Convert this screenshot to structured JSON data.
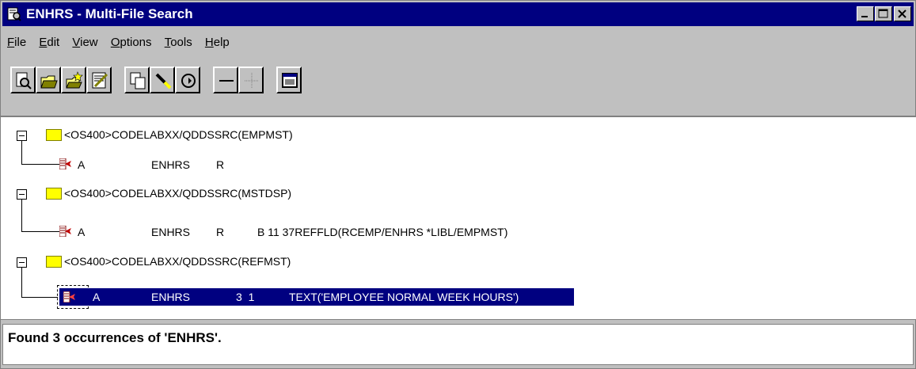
{
  "window": {
    "title": "ENHRS - Multi-File Search"
  },
  "menu": [
    {
      "label": "File",
      "accel": "F",
      "rest": "ile"
    },
    {
      "label": "Edit",
      "accel": "E",
      "rest": "dit"
    },
    {
      "label": "View",
      "accel": "V",
      "rest": "iew"
    },
    {
      "label": "Options",
      "accel": "O",
      "rest": "ptions"
    },
    {
      "label": "Tools",
      "accel": "T",
      "rest": "ools"
    },
    {
      "label": "Help",
      "accel": "H",
      "rest": "elp"
    }
  ],
  "toolbar": {
    "buttons": [
      "find-icon",
      "open-folder-icon",
      "open-multiple-icon",
      "edit-icon",
      "copy-icon",
      "highlight-icon",
      "refresh-icon",
      "collapse-icon",
      "expand-icon",
      "window-icon"
    ]
  },
  "tree": {
    "groups": [
      {
        "path": "<OS400>CODELABXX/QDDSSRC(EMPMST)",
        "record": {
          "col1": "A",
          "col2": "ENHRS",
          "col3": "R",
          "col4": ""
        }
      },
      {
        "path": "<OS400>CODELABXX/QDDSSRC(MSTDSP)",
        "record": {
          "col1": "A",
          "col2": "ENHRS",
          "col3": "R",
          "col4": "B 11 37REFFLD(RCEMP/ENHRS *LIBL/EMPMST)"
        }
      },
      {
        "path": "<OS400>CODELABXX/QDDSSRC(REFMST)",
        "record": {
          "col1": "A",
          "col2": "ENHRS",
          "col3": "3  1",
          "col4": "TEXT('EMPLOYEE NORMAL WEEK HOURS')"
        }
      }
    ]
  },
  "status": {
    "message": "Found 3 occurrences of 'ENHRS'."
  },
  "colors": {
    "titlebar": "#000080",
    "selection": "#000080",
    "folder": "#ffff00"
  }
}
